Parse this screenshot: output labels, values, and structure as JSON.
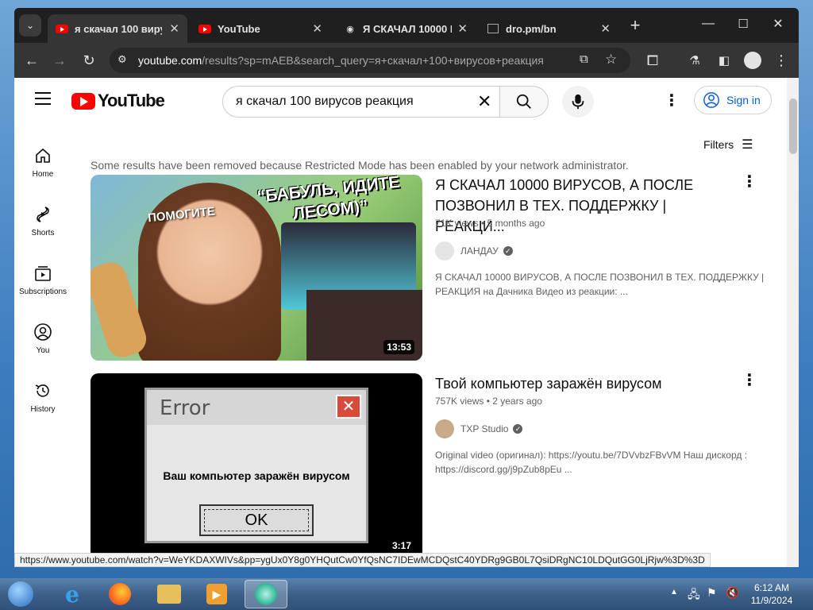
{
  "browser": {
    "tabs": [
      {
        "label": "я скачал 100 вирусов",
        "active": true
      },
      {
        "label": "YouTube",
        "active": false
      },
      {
        "label": "Я СКАЧАЛ 10000 ВИ",
        "active": false
      },
      {
        "label": "dro.pm/bn",
        "active": false
      }
    ],
    "new_tab_label": "+",
    "url_host": "youtube.com",
    "url_rest": "/results?sp=mAEB&search_query=я+скачал+100+вирусов+реакция",
    "status_url": "https://www.youtube.com/watch?v=WeYKDAXWIVs&pp=ygUx0Y8g0YHQutCw0YfQsNC7IDEwMCDQstC40YDRg9GB0L7QsiDRgNC10LDQutGG0LjRjw%3D%3D"
  },
  "youtube": {
    "logo_text": "YouTube",
    "search_value": "я скачал 100 вирусов реакция",
    "sign_in": "Sign in",
    "filters": "Filters",
    "notice": "Some results have been removed because Restricted Mode has been enabled by your network administrator.",
    "guide": [
      {
        "label": "Home",
        "icon": "home-icon"
      },
      {
        "label": "Shorts",
        "icon": "shorts-icon"
      },
      {
        "label": "Subscriptions",
        "icon": "subscriptions-icon"
      },
      {
        "label": "You",
        "icon": "you-icon"
      },
      {
        "label": "History",
        "icon": "history-icon"
      }
    ],
    "videos": [
      {
        "title": "Я СКАЧАЛ 10000 ВИРУСОВ, А ПОСЛЕ ПОЗВОНИЛ В ТЕХ. ПОДДЕРЖКУ | РЕАКЦИ...",
        "meta": "71K views • 5 months ago",
        "channel": "ЛАНДАУ",
        "description": "Я СКАЧАЛ 10000 ВИРУСОВ, А ПОСЛЕ ПОЗВОНИЛ В ТЕХ. ПОДДЕРЖКУ | РЕАКЦИЯ на Дачника Видео из реакции: ...",
        "duration": "13:53",
        "thumb_text_1": "ПОМОГИТЕ",
        "thumb_text_2": "“БАБУЛЬ, ИДИТЕ ЛЕСОМ)”"
      },
      {
        "title": "Твой компьютер заражён вирусом",
        "meta": "757K views • 2 years ago",
        "channel": "TXP Studio",
        "description": "Original video (оригинал): https://youtu.be/7DVvbzFBvVM Наш дискорд : https://discord.gg/j9pZub8pEu ...",
        "duration": "3:17",
        "error_title": "Error",
        "error_message": "Ваш компьютер заражён вирусом",
        "error_ok": "OK"
      }
    ]
  },
  "taskbar": {
    "time": "6:12 AM",
    "date": "11/9/2024"
  },
  "colors": {
    "yt_red": "#ff0000",
    "link_blue": "#065fd4",
    "chrome_dark": "#1f1f1f",
    "chrome_toolbar": "#353535"
  }
}
